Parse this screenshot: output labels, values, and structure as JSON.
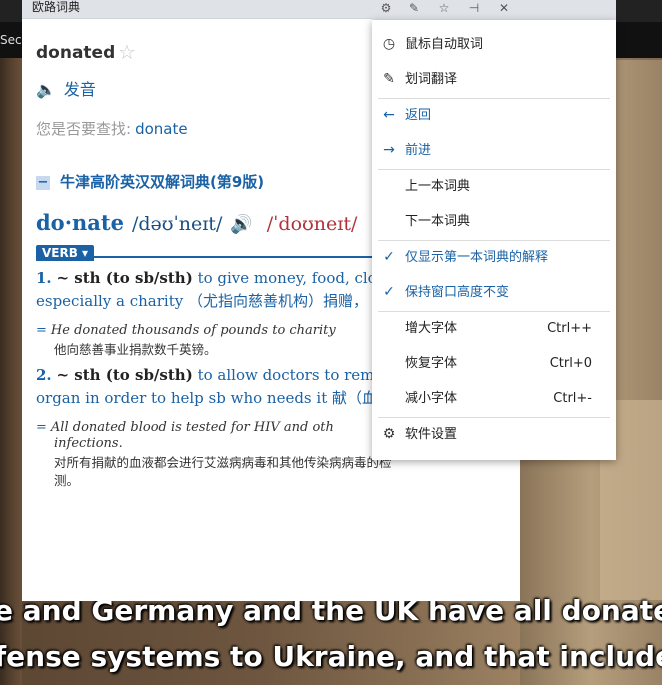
{
  "background": {
    "tab_text": "Secr",
    "subtitle_line1": "e and Germany and the UK have all donated",
    "subtitle_line2": "fense systems to Ukraine, and that includes"
  },
  "window": {
    "title": "欧路词典",
    "buttons": [
      "settings-icon",
      "edit-icon",
      "star-icon",
      "pin-icon",
      "close-icon"
    ]
  },
  "entry": {
    "word": "donated",
    "pronounce_label": "发音",
    "suggest_label": "您是否要查找:",
    "suggest_word": "donate"
  },
  "dictionary": {
    "name": "牛津高阶英汉双解词典(第9版)",
    "toggle": "−",
    "headword": "do·nate",
    "ipa_uk": "/dəʊˈneɪt/",
    "ipa_us": "/ˈdoʊneɪt/",
    "pos": "VERB ▾",
    "senses": [
      {
        "num": "1.",
        "pattern": "~ sth (to sb/sth)",
        "def_line1": "to give money, food, cloth",
        "def_line2": "especially a charity （尤指向慈善机构）捐赠，",
        "example": "He donated thousands of pounds to charity",
        "example_zh": "他向慈善事业捐款数千英镑。"
      },
      {
        "num": "2.",
        "pattern": "~ sth (to sb/sth)",
        "def_line1": "to allow doctors to remov",
        "def_line2": "organ in order to help sb who needs it 献（血",
        "example_line1": "All donated blood is tested for HIV and oth",
        "example_line2": "infections.",
        "example_zh_line1": "对所有捐献的血液都会进行艾滋病病毒和其他传染病病毒的检",
        "example_zh_line2": "测。"
      }
    ]
  },
  "menu": {
    "items": [
      {
        "icon": "clock-icon",
        "label": "鼠标自动取词",
        "shortcut": ""
      },
      {
        "icon": "pen-icon",
        "label": "划词翻译",
        "shortcut": ""
      },
      {
        "icon": "arrow-left-icon",
        "label": "返回",
        "shortcut": ""
      },
      {
        "icon": "arrow-right-icon",
        "label": "前进",
        "shortcut": ""
      },
      {
        "icon": "",
        "label": "上一本词典",
        "shortcut": ""
      },
      {
        "icon": "",
        "label": "下一本词典",
        "shortcut": ""
      },
      {
        "icon": "check-icon",
        "label": "仅显示第一本词典的解释",
        "shortcut": ""
      },
      {
        "icon": "check-icon",
        "label": "保持窗口高度不变",
        "shortcut": ""
      },
      {
        "icon": "",
        "label": "增大字体",
        "shortcut": "Ctrl++"
      },
      {
        "icon": "",
        "label": "恢复字体",
        "shortcut": "Ctrl+0"
      },
      {
        "icon": "",
        "label": "减小字体",
        "shortcut": "Ctrl+-"
      },
      {
        "icon": "gear-icon",
        "label": "软件设置",
        "shortcut": ""
      }
    ]
  }
}
